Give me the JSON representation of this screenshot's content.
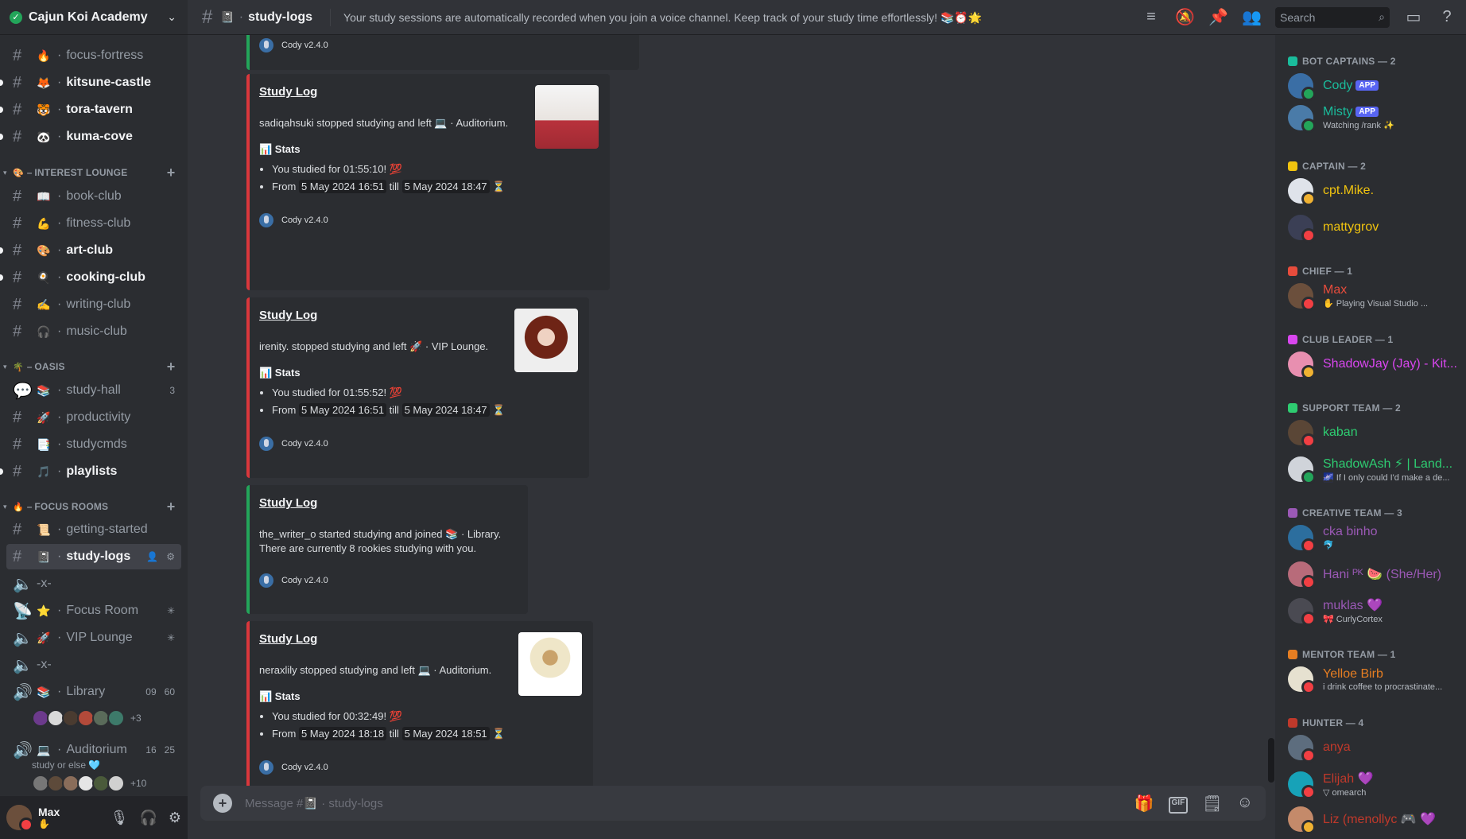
{
  "server": {
    "name": "Cajun Koi Academy"
  },
  "channel_header": {
    "emoji": "📓",
    "name": "study-logs",
    "topic": "Your study sessions are automatically recorded when you join a voice channel. Keep track of your study time effortlessly! 📚⏰🌟",
    "search_placeholder": "Search"
  },
  "sidebar": {
    "channels_top": [
      {
        "emoji": "🔥",
        "name": "focus-fortress",
        "unread": false
      },
      {
        "emoji": "🦊",
        "name": "kitsune-castle",
        "unread": true
      },
      {
        "emoji": "🐯",
        "name": "tora-tavern",
        "unread": true
      },
      {
        "emoji": "🐼",
        "name": "kuma-cove",
        "unread": true
      }
    ],
    "cat_interest": {
      "emoji": "🎨",
      "label": "INTEREST LOUNGE"
    },
    "channels_interest": [
      {
        "emoji": "📖",
        "name": "book-club",
        "unread": false
      },
      {
        "emoji": "💪",
        "name": "fitness-club",
        "unread": false
      },
      {
        "emoji": "🎨",
        "name": "art-club",
        "unread": true
      },
      {
        "emoji": "🍳",
        "name": "cooking-club",
        "unread": true
      },
      {
        "emoji": "✍️",
        "name": "writing-club",
        "unread": false
      },
      {
        "emoji": "🎧",
        "name": "music-club",
        "unread": false
      }
    ],
    "cat_oasis": {
      "emoji": "🌴",
      "label": "OASIS"
    },
    "channels_oasis": [
      {
        "emoji": "📚",
        "name": "study-hall",
        "count": "3"
      },
      {
        "emoji": "🚀",
        "name": "productivity"
      },
      {
        "emoji": "📑",
        "name": "studycmds"
      },
      {
        "emoji": "🎵",
        "name": "playlists",
        "unread": true
      }
    ],
    "cat_focus": {
      "emoji": "🔥",
      "label": "FOCUS ROOMS"
    },
    "channels_focus": [
      {
        "emoji": "📜",
        "name": "getting-started"
      },
      {
        "emoji": "📓",
        "name": "study-logs",
        "active": true
      }
    ],
    "voice": [
      {
        "name": "-x-"
      },
      {
        "emoji": "⭐",
        "name": "Focus Room"
      },
      {
        "emoji": "🚀",
        "name": "VIP Lounge"
      },
      {
        "name": "-x-"
      },
      {
        "emoji": "📚",
        "name": "Library",
        "time": "09",
        "limit": "60",
        "more": "+3"
      },
      {
        "emoji": "💻",
        "name": "Auditorium",
        "time": "16",
        "limit": "25",
        "sub": "study or else 🩵",
        "more": "+10"
      }
    ]
  },
  "user": {
    "name": "Max",
    "status": "✋"
  },
  "messages": [
    {
      "footer": "Cody v2.4.0"
    },
    {
      "title": "Study Log",
      "desc_pre": "sadiqahsuki stopped studying and left 💻 · Auditorium.",
      "stats_label": "📊 Stats",
      "studied": "You studied for 01:55:10! 💯",
      "from_label": "From",
      "from": "5 May 2024 16:51",
      "till_label": "till",
      "till": "5 May 2024 18:47",
      "hourglass": "⏳",
      "footer": "Cody v2.4.0"
    },
    {
      "title": "Study Log",
      "desc_pre": "irenity. stopped studying and left 🚀 · VIP Lounge.",
      "stats_label": "📊 Stats",
      "studied": "You studied for 01:55:52! 💯",
      "from_label": "From",
      "from": "5 May 2024 16:51",
      "till_label": "till",
      "till": "5 May 2024 18:47",
      "hourglass": "⏳",
      "footer": "Cody v2.4.0"
    },
    {
      "title": "Study Log",
      "desc_pre": "the_writer_o started studying and joined 📚 · Library.",
      "desc_line2": "There are currently 8 rookies studying with you.",
      "footer": "Cody v2.4.0"
    },
    {
      "title": "Study Log",
      "desc_pre": "neraxlily stopped studying and left 💻 · Auditorium.",
      "stats_label": "📊 Stats",
      "studied": "You studied for 00:32:49! 💯",
      "from_label": "From",
      "from": "5 May 2024 18:18",
      "till_label": "till",
      "till": "5 May 2024 18:51",
      "hourglass": "⏳",
      "footer": "Cody v2.4.0"
    }
  ],
  "composer": {
    "placeholder": "Message #📓 · study-logs"
  },
  "members": {
    "roles": [
      {
        "label": "BOT CAPTAINS — 2",
        "color": "#1abc9c"
      },
      {
        "label": "CAPTAIN — 2",
        "color": "#f1c40f"
      },
      {
        "label": "CHIEF — 1",
        "color": "#e74c3c"
      },
      {
        "label": "CLUB LEADER — 1",
        "color": "#d946ef"
      },
      {
        "label": "SUPPORT TEAM — 2",
        "color": "#2ecc71"
      },
      {
        "label": "CREATIVE TEAM — 3",
        "color": "#9b59b6"
      },
      {
        "label": "MENTOR TEAM — 1",
        "color": "#e67e22"
      },
      {
        "label": "HUNTER — 4",
        "color": "#c0392b"
      }
    ],
    "list": [
      {
        "name": "Cody",
        "app": "APP",
        "color": "#1abc9c",
        "avatar": "#3a6ea5",
        "status_color": "#23a55a"
      },
      {
        "name": "Misty",
        "app": "APP",
        "sub": "Watching /rank ✨",
        "color": "#1abc9c",
        "avatar": "#4a7ba8",
        "status_color": "#23a55a"
      },
      {
        "name": "cpt.Mike.",
        "color": "#f1c40f",
        "avatar": "#dfe3ea",
        "status_color": "#f0b232"
      },
      {
        "name": "mattygrov",
        "color": "#f1c40f",
        "avatar": "#3b3f55",
        "status_color": "#f23f43"
      },
      {
        "name": "Max",
        "sub": "✋ Playing Visual Studio ...",
        "color": "#e74c3c",
        "avatar": "#6b4f3c",
        "status_color": "#f23f43"
      },
      {
        "name": "ShadowJay (Jay) - Kit...",
        "color": "#d946ef",
        "avatar": "#e88fb0",
        "status_color": "#f0b232"
      },
      {
        "name": "kaban",
        "color": "#2ecc71",
        "avatar": "#5a4636",
        "status_color": "#f23f43"
      },
      {
        "name": "ShadowAsh ⚡ | Land...",
        "sub": "🌌 If I only could I'd make a de...",
        "color": "#2ecc71",
        "avatar": "#d0d4da",
        "status_color": "#23a55a"
      },
      {
        "name": "cka binho",
        "sub": "🐬",
        "color": "#9b59b6",
        "avatar": "#2c6e9e",
        "status_color": "#f23f43"
      },
      {
        "name": "Hani ᴾᴷ 🍉 (She/Her)",
        "color": "#9b59b6",
        "avatar": "#b86b7a",
        "status_color": "#f23f43"
      },
      {
        "name": "muklas 💜",
        "sub": "🎀 CurlyCortex",
        "color": "#9b59b6",
        "avatar": "#4a4a52",
        "status_color": "#f23f43"
      },
      {
        "name": "Yelloe Birb",
        "sub": "i drink coffee to procrastinate...",
        "color": "#e67e22",
        "avatar": "#e6e1d0",
        "status_color": "#f23f43"
      },
      {
        "name": "anya",
        "color": "#c0392b",
        "avatar": "#5d6d7e",
        "status_color": "#f23f43"
      },
      {
        "name": "Elijah 💜",
        "sub": "▽ omearch",
        "color": "#c0392b",
        "avatar": "#17a2b8",
        "status_color": "#f23f43"
      },
      {
        "name": "Liz (menollyc 🎮 💜",
        "color": "#c0392b",
        "avatar": "#c48a6a",
        "status_color": "#f0b232"
      }
    ]
  }
}
